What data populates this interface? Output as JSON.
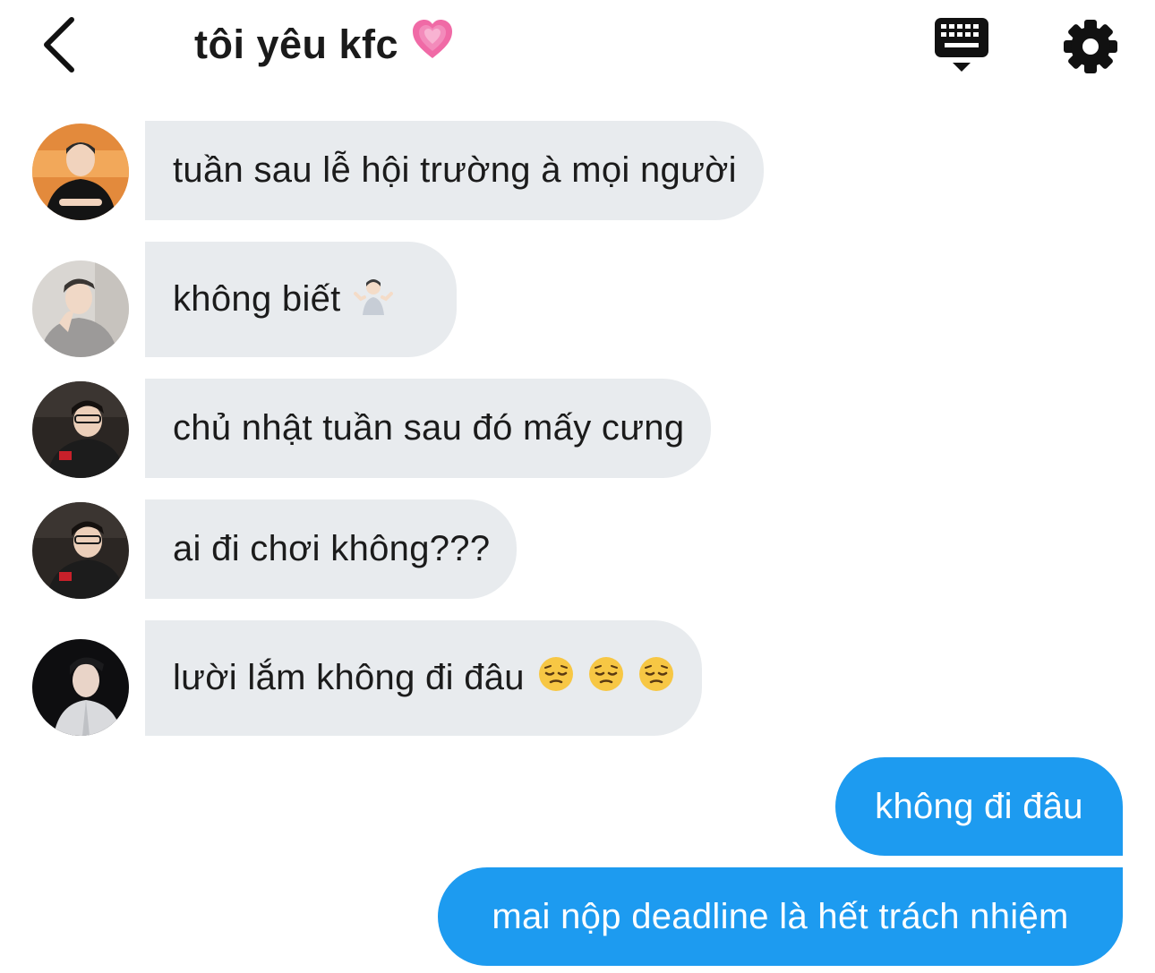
{
  "header": {
    "title": "tôi yêu kfc",
    "title_emoji": "growing-heart",
    "back_icon": "chevron-left-icon",
    "keyboard_icon": "keyboard-icon",
    "settings_icon": "gear-icon"
  },
  "messages": [
    {
      "side": "in",
      "text": "tuần sau lễ hội trường à mọi người",
      "avatar": "avatar-orange-bg"
    },
    {
      "side": "in",
      "text": "không biết",
      "emoji": "person-shrugging",
      "avatar": "avatar-grey-bg"
    },
    {
      "side": "in",
      "text": "chủ nhật tuần sau đó mấy cưng",
      "avatar": "avatar-dark-bg"
    },
    {
      "side": "in",
      "text": "ai đi chơi không???",
      "avatar": "avatar-dark-bg"
    },
    {
      "side": "in",
      "text": "lười lắm không đi đâu",
      "emoji": "pensive-face x3",
      "avatar": "avatar-black-bg"
    },
    {
      "side": "out",
      "text": "không đi đâu"
    },
    {
      "side": "out",
      "text": "mai nộp deadline là hết trách nhiệm"
    }
  ],
  "colors": {
    "incoming_bubble": "#e8ebee",
    "outgoing_bubble": "#1d9bf0",
    "outgoing_text": "#ffffff"
  }
}
